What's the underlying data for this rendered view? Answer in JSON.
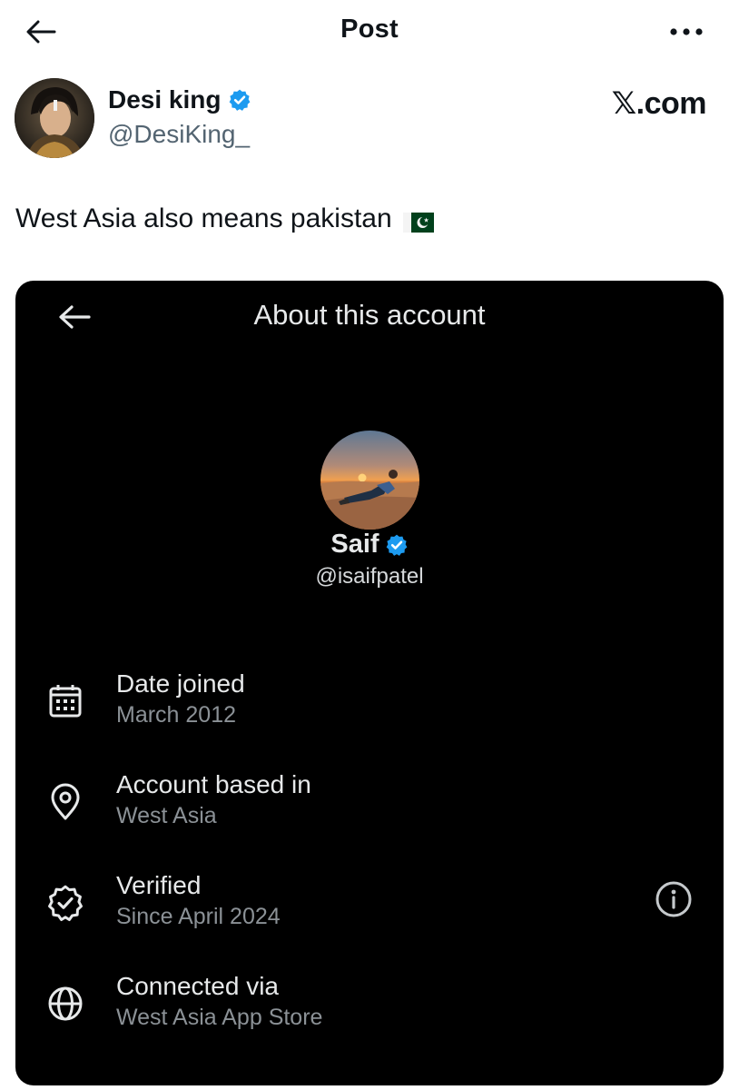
{
  "header": {
    "title": "Post",
    "back_icon": "arrow-left-icon",
    "more_icon": "more-horizontal-icon"
  },
  "author": {
    "name": "Desi king",
    "handle": "@DesiKing_",
    "verified_icon": "verified-badge-icon",
    "verified_color": "#1d9bf0"
  },
  "brand": {
    "label": "𝕏.com"
  },
  "post": {
    "text": "West Asia also means pakistan",
    "flag_icon": "pakistan-flag-icon"
  },
  "embedded": {
    "title": "About this account",
    "back_icon": "arrow-left-icon",
    "profile": {
      "name": "Saif",
      "handle": "@isaifpatel",
      "verified_icon": "verified-badge-icon"
    },
    "rows": [
      {
        "icon": "calendar-icon",
        "title": "Date joined",
        "value": "March 2012"
      },
      {
        "icon": "location-pin-icon",
        "title": "Account based in",
        "value": "West Asia"
      },
      {
        "icon": "verified-check-icon",
        "title": "Verified",
        "value": "Since April 2024",
        "action_icon": "info-icon"
      },
      {
        "icon": "globe-icon",
        "title": "Connected via",
        "value": "West Asia App Store"
      }
    ],
    "colors": {
      "background": "#000000",
      "text": "#e7e9ea",
      "secondary_text": "#8b9196"
    }
  }
}
